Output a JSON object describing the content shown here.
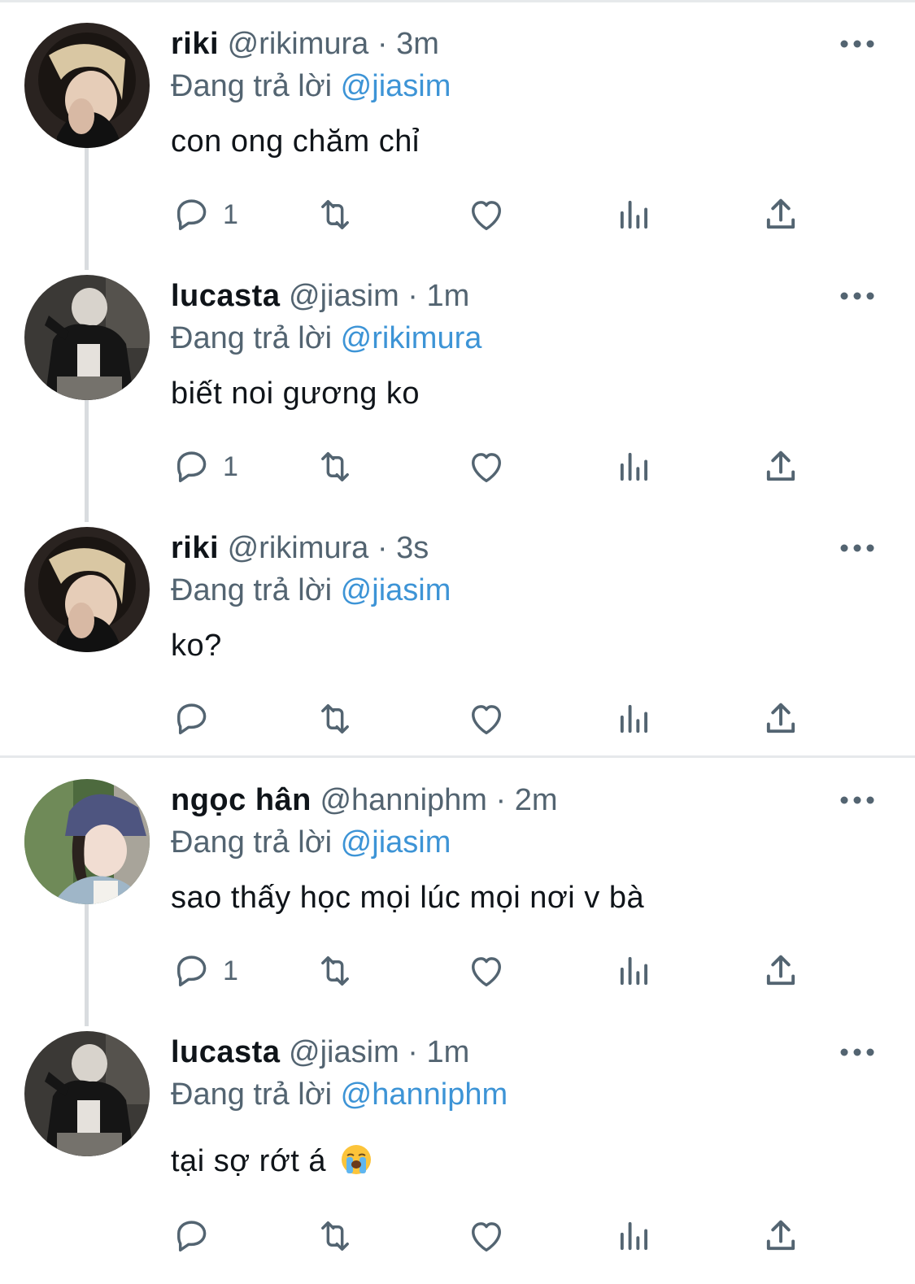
{
  "tweets": [
    {
      "name": "riki",
      "handle": "@rikimura",
      "time": "3m",
      "reply_prefix": "Đang trả lời",
      "reply_to": "@jiasim",
      "text": "con ong chăm chỉ",
      "reply_count": "1",
      "avatar": "avatar-riki"
    },
    {
      "name": "lucasta",
      "handle": "@jiasim",
      "time": "1m",
      "reply_prefix": "Đang trả lời",
      "reply_to": "@rikimura",
      "text": "biết noi gương ko",
      "reply_count": "1",
      "avatar": "avatar-lucasta"
    },
    {
      "name": "riki",
      "handle": "@rikimura",
      "time": "3s",
      "reply_prefix": "Đang trả lời",
      "reply_to": "@jiasim",
      "text": "ko?",
      "reply_count": "",
      "avatar": "avatar-riki"
    },
    {
      "name": "ngọc hân",
      "handle": "@hanniphm",
      "time": "2m",
      "reply_prefix": "Đang trả lời",
      "reply_to": "@jiasim",
      "text": "sao thấy học mọi lúc mọi nơi v bà",
      "reply_count": "1",
      "avatar": "avatar-ngochan"
    },
    {
      "name": "lucasta",
      "handle": "@jiasim",
      "time": "1m",
      "reply_prefix": "Đang trả lời",
      "reply_to": "@hanniphm",
      "text": "tại sợ rớt á",
      "reply_count": "",
      "avatar": "avatar-lucasta",
      "emoji": "loudly-crying-face"
    }
  ],
  "separator": "·",
  "icons": [
    "reply-icon",
    "retweet-icon",
    "like-icon",
    "views-icon",
    "share-icon",
    "more-icon"
  ],
  "colors": {
    "mention": "#3d94d6",
    "secondary": "#536471",
    "thread_line": "#d9dcdf"
  }
}
